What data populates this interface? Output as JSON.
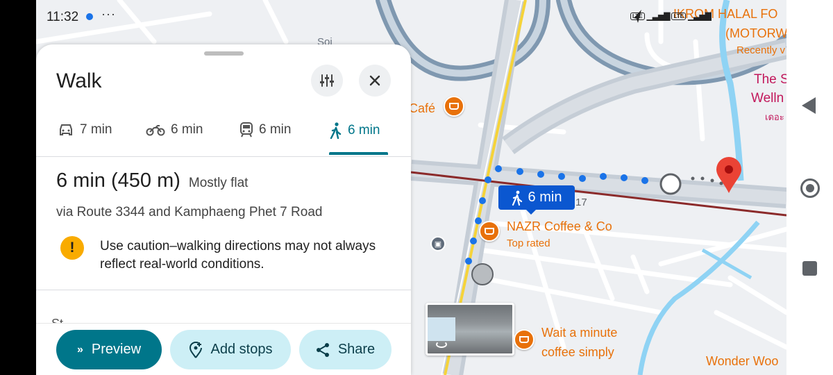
{
  "status_bar": {
    "time": "11:32",
    "more": "···",
    "lte1": "LTE",
    "lte2": "LTE"
  },
  "map": {
    "labels": {
      "cafe_partial": "Café",
      "halal_line1": "IKROM HALAL FO",
      "halal_line2": "(MOTORW",
      "halal_line3": "Recently v",
      "pink_line1": "The S",
      "pink_line2": "Welln",
      "pink_line3": "เดอะ",
      "nazr_name": "NAZR Coffee & Co",
      "nazr_sub": "Top rated",
      "wait_line1": "Wait a minute",
      "wait_line2": "coffee simply",
      "wonder": "Wonder Woo",
      "road_number": "17",
      "soi_label": "Soi"
    },
    "route_badge": "6 min",
    "colors": {
      "route_dots": "#1a73e8",
      "destination_pin": "#ea4335",
      "poi": "#e8710a",
      "rail_line": "#8b2a2a",
      "water": "#8fd3f4"
    }
  },
  "sheet": {
    "title": "Walk",
    "options_icon": "tune-icon",
    "close_icon": "close-icon",
    "tabs": [
      {
        "mode": "car-icon",
        "label": "7 min"
      },
      {
        "mode": "motorbike-icon",
        "label": "6 min"
      },
      {
        "mode": "transit-icon",
        "label": "6 min"
      },
      {
        "mode": "walk-icon",
        "label": "6 min",
        "active": true
      }
    ],
    "summary_time": "6 min (450 m)",
    "summary_terrain": "Mostly flat",
    "via": "via Route 3344 and Kamphaeng Phet 7 Road",
    "warning_mark": "!",
    "warning": "Use caution–walking directions may not always reflect real-world conditions.",
    "steps_peek": "St"
  },
  "actions": {
    "preview": "Preview",
    "add_stops": "Add stops",
    "share": "Share"
  }
}
